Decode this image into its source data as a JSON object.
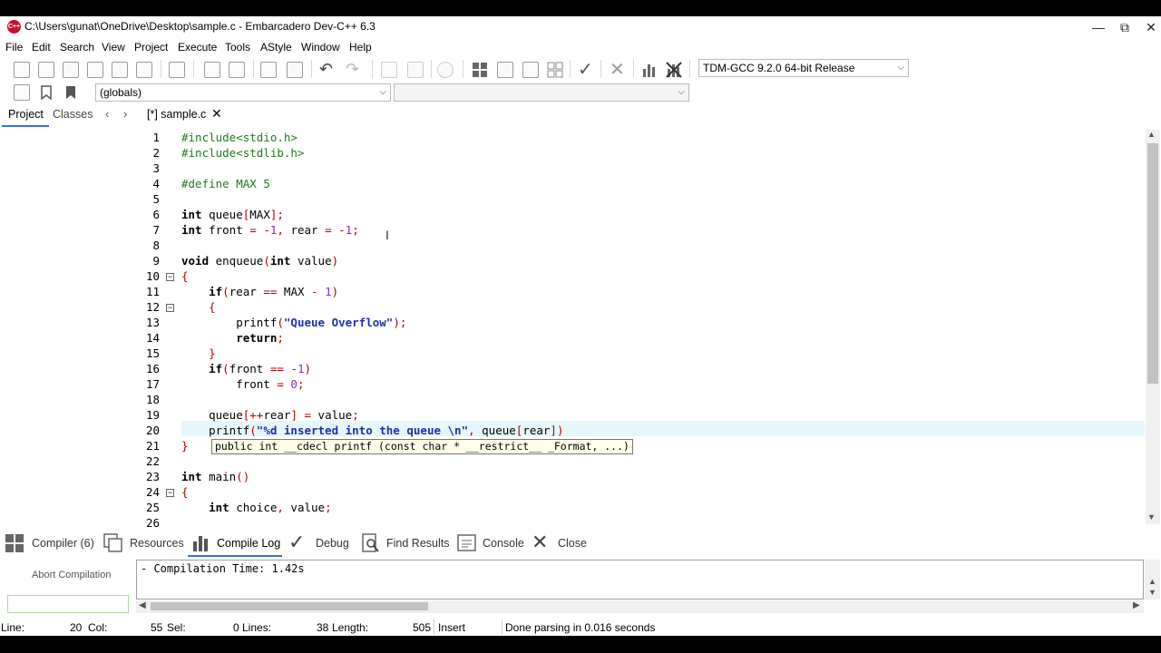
{
  "window": {
    "title": "C:\\Users\\gunat\\OneDrive\\Desktop\\sample.c - Embarcadero Dev-C++ 6.3",
    "icon_text": "C++"
  },
  "menu": [
    "File",
    "Edit",
    "Search",
    "View",
    "Project",
    "Execute",
    "Tools",
    "AStyle",
    "Window",
    "Help"
  ],
  "toolbar": {
    "compiler_select": "TDM-GCC 9.2.0 64-bit Release",
    "scope_select": "(globals)",
    "member_select": ""
  },
  "panel_tabs": [
    "Project",
    "Classes"
  ],
  "file_tab": "[*] sample.c",
  "editor": {
    "lines": [
      {
        "n": "1",
        "code": "#include<stdio.h>"
      },
      {
        "n": "2",
        "code": "#include<stdlib.h>"
      },
      {
        "n": "3",
        "code": ""
      },
      {
        "n": "4",
        "code": "#define MAX 5"
      },
      {
        "n": "5",
        "code": ""
      },
      {
        "n": "6",
        "code": "int queue[MAX];"
      },
      {
        "n": "7",
        "code": "int front = -1, rear = -1;"
      },
      {
        "n": "8",
        "code": ""
      },
      {
        "n": "9",
        "code": "void enqueue(int value)"
      },
      {
        "n": "10",
        "code": "{"
      },
      {
        "n": "11",
        "code": "    if(rear == MAX - 1)"
      },
      {
        "n": "12",
        "code": "    {"
      },
      {
        "n": "13",
        "code": "        printf(\"Queue Overflow\");"
      },
      {
        "n": "14",
        "code": "        return;"
      },
      {
        "n": "15",
        "code": "    }"
      },
      {
        "n": "16",
        "code": "    if(front == -1)"
      },
      {
        "n": "17",
        "code": "        front = 0;"
      },
      {
        "n": "18",
        "code": ""
      },
      {
        "n": "19",
        "code": "    queue[++rear] = value;"
      },
      {
        "n": "20",
        "code": "    printf(\"%d inserted into the queue \\n\", queue[rear])"
      },
      {
        "n": "21",
        "code": "}"
      },
      {
        "n": "22",
        "code": ""
      },
      {
        "n": "23",
        "code": "int main()"
      },
      {
        "n": "24",
        "code": "{"
      },
      {
        "n": "25",
        "code": "    int choice, value;"
      },
      {
        "n": "26",
        "code": ""
      }
    ],
    "hint": "public int __cdecl printf (const char * __restrict__ _Format, ...)"
  },
  "bottom_tabs": [
    "Compiler (6)",
    "Resources",
    "Compile Log",
    "Debug",
    "Find Results",
    "Console",
    "Close"
  ],
  "abort_label": "Abort Compilation",
  "compile_log": "- Compilation Time: 1.42s",
  "status": {
    "line_label": "Line:",
    "line_val": "20",
    "col_label": "Col:",
    "col_val": "55",
    "sel_label": "Sel:",
    "sel_val": "0",
    "lines_label": "Lines:",
    "lines_val": "38",
    "length_label": "Length:",
    "length_val": "505",
    "mode": "Insert",
    "message": "Done parsing in 0.016 seconds"
  }
}
